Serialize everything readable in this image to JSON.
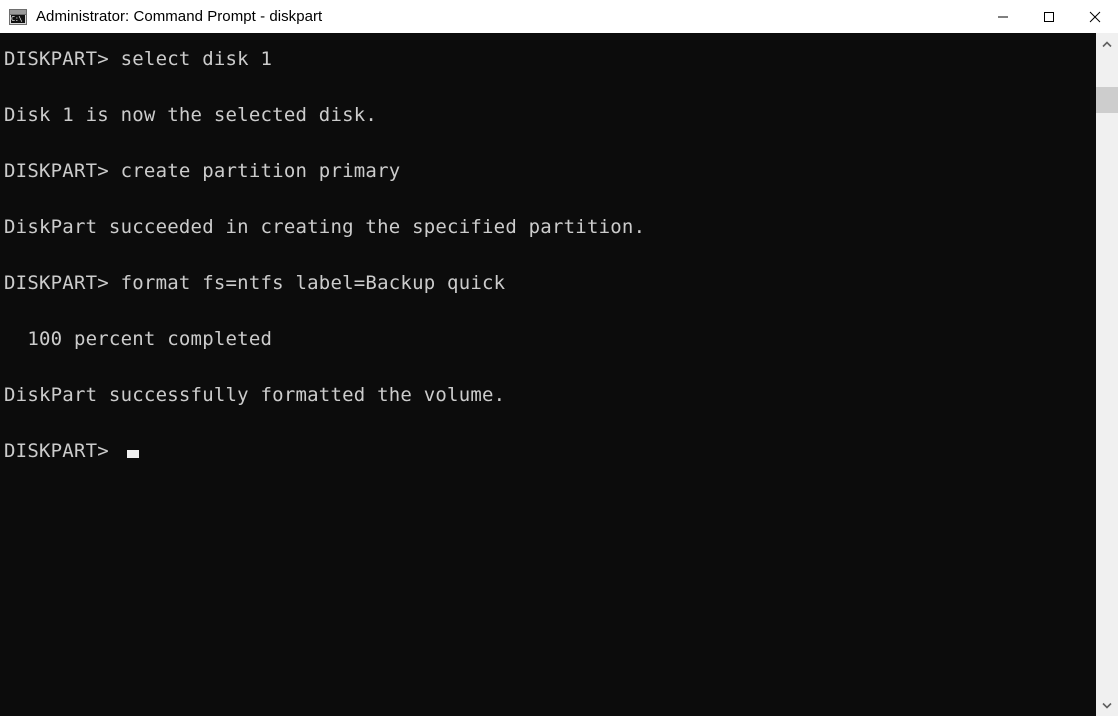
{
  "window": {
    "title": "Administrator: Command Prompt - diskpart",
    "icon": "cmd-console-icon",
    "icon_glyph": "C:\\",
    "background_color": "#0c0c0c",
    "titlebar_color": "#ffffff",
    "text_color": "#cccccc"
  },
  "window_controls": {
    "minimize": {
      "name": "minimize-button",
      "label": "Minimize",
      "icon": "minimize-icon"
    },
    "maximize": {
      "name": "maximize-button",
      "label": "Maximize",
      "icon": "maximize-icon"
    },
    "close": {
      "name": "close-button",
      "label": "Close",
      "icon": "close-icon"
    }
  },
  "console": {
    "prompt": "DISKPART>",
    "lines": [
      "DISKPART> select disk 1",
      "",
      "Disk 1 is now the selected disk.",
      "",
      "DISKPART> create partition primary",
      "",
      "DiskPart succeeded in creating the specified partition.",
      "",
      "DISKPART> format fs=ntfs label=Backup quick",
      "",
      "  100 percent completed",
      "",
      "DiskPart successfully formatted the volume.",
      ""
    ],
    "current_prompt": "DISKPART> ",
    "cursor": "block-cursor"
  },
  "scrollbar": {
    "up_arrow": "scroll-up-icon",
    "down_arrow": "scroll-down-icon",
    "thumb": "scrollbar-thumb",
    "track_color": "#f0f0f0",
    "thumb_color": "#cdcdcd"
  }
}
